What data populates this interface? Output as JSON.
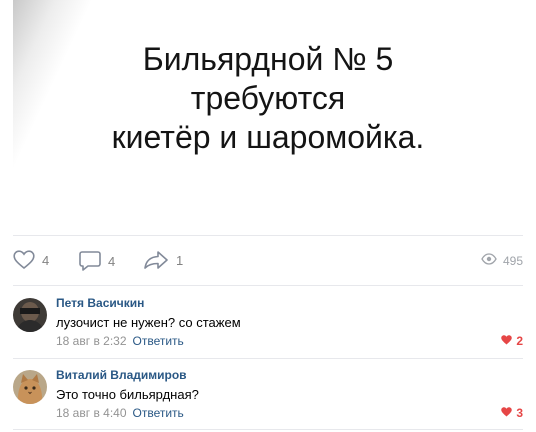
{
  "post": {
    "text_lines": [
      "Бильярдной № 5",
      "требуются",
      "киетёр и шаромойка."
    ]
  },
  "actions": {
    "likes": "4",
    "comments": "4",
    "shares": "1",
    "views": "495"
  },
  "comments": [
    {
      "author": "Петя Васичкин",
      "text": "лузочист не нужен? со стажем",
      "time": "18 авг в 2:32",
      "reply_label": "Ответить",
      "likes": "2"
    },
    {
      "author": "Виталий Владимиров",
      "text": "Это точно бильярдная?",
      "time": "18 авг в 4:40",
      "reply_label": "Ответить",
      "likes": "3"
    }
  ],
  "colors": {
    "link": "#2a5885",
    "meta": "#939393",
    "like_active": "#e64646",
    "separator": "#e7e8ec"
  },
  "icons": [
    "heart-icon",
    "comment-icon",
    "share-icon",
    "eye-icon",
    "heart-filled-icon"
  ]
}
